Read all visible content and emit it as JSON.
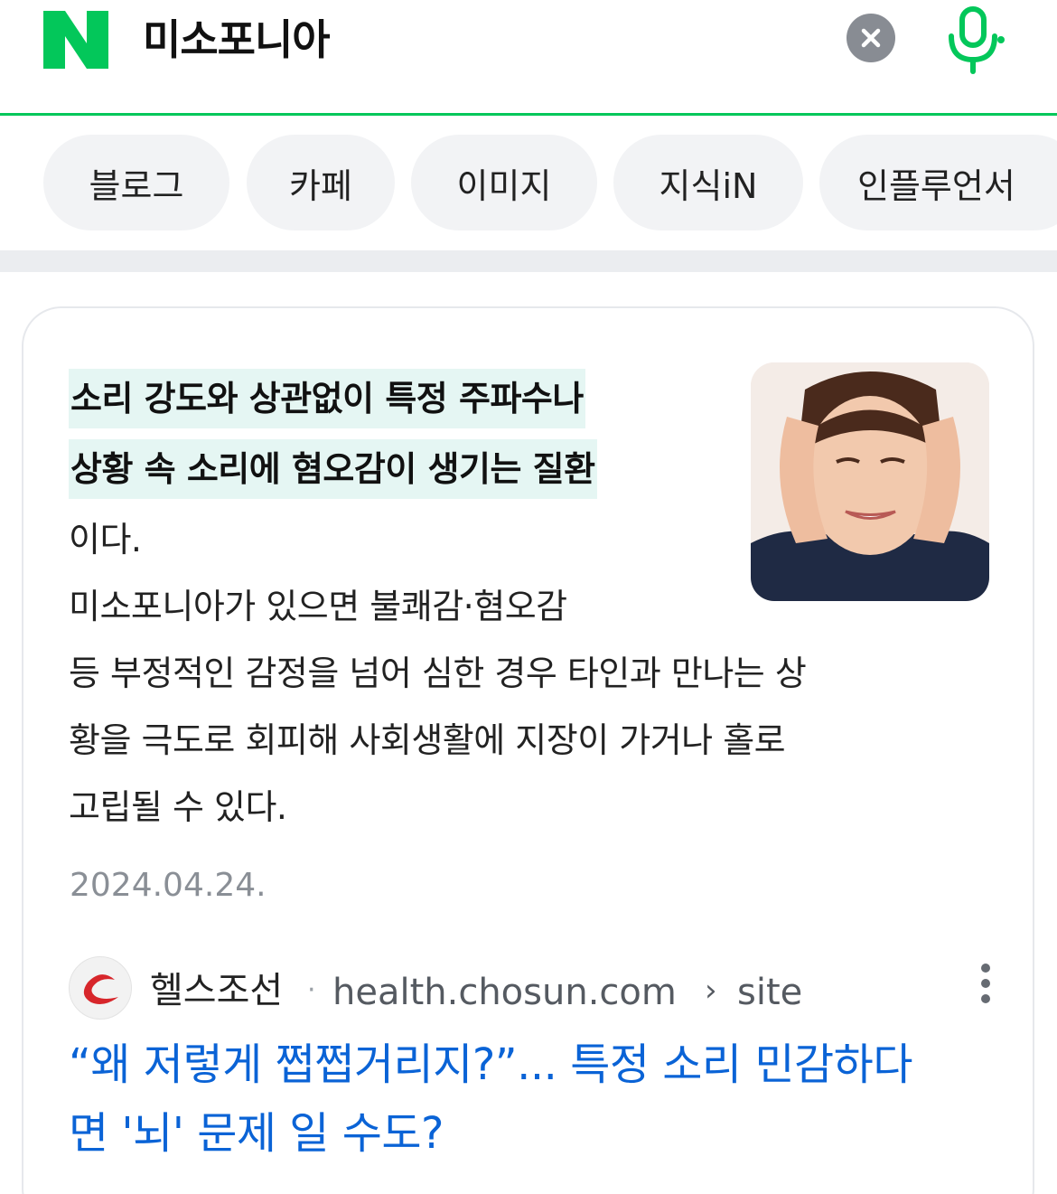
{
  "search": {
    "logo_letter": "N",
    "query": "미소포니아",
    "clear_icon": "close-icon",
    "mic_icon": "microphone-icon",
    "brand_color": "#03c75a"
  },
  "tabs": [
    {
      "label": "블로그"
    },
    {
      "label": "카페"
    },
    {
      "label": "이미지"
    },
    {
      "label": "지식iN"
    },
    {
      "label": "인플루언서"
    }
  ],
  "snippet": {
    "highlight_lines": [
      "소리 강도와 상관없이 특정 주파수나",
      "상황 속 소리에 혐오감이 생기는 질환"
    ],
    "lines": [
      "이다.",
      "미소포니아가 있으면 불쾌감·혐오감",
      "등 부정적인 감정을 넘어 심한 경우 타인과 만나는 상",
      "황을 극도로 회피해 사회생활에 지장이 가거나 홀로",
      "고립될 수 있다."
    ],
    "highlight_color": "#e5f6f3",
    "date": "2024.04.24."
  },
  "source": {
    "name": "헬스조선",
    "separator": "·",
    "url": "health.chosun.com",
    "chevron": "›",
    "path": "site",
    "more_icon": "more-vertical-icon"
  },
  "article": {
    "title_lines": [
      "“왜 저렇게 쩝쩝거리지?”... 특정 소리 민감하다",
      "면 '뇌' 문제 일 수도?"
    ],
    "link_color": "#0a63d6"
  }
}
